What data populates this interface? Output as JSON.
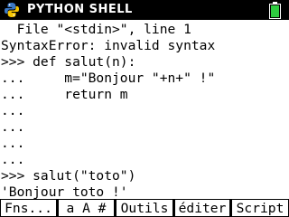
{
  "header": {
    "title": "PYTHON SHELL",
    "icon": "python-logo-icon",
    "battery_icon": "battery-icon",
    "colors": {
      "background": "#000000",
      "text": "#ffffff",
      "battery": "#2ecc40",
      "logo_blue": "#3b78c6",
      "logo_yellow": "#f5c400"
    }
  },
  "shell": {
    "lines": [
      "  File \"<stdin>\", line 1",
      "SyntaxError: invalid syntax",
      ">>> def salut(n):",
      "...     m=\"Bonjour \"+n+\" !\"",
      "...     return m",
      "...",
      "...",
      "...",
      "...",
      ">>> salut(\"toto\")",
      "'Bonjour toto !'",
      ">>> "
    ]
  },
  "menu": {
    "items": [
      "Fns...",
      "a A #",
      "Outils",
      "éditer",
      "Script"
    ]
  }
}
